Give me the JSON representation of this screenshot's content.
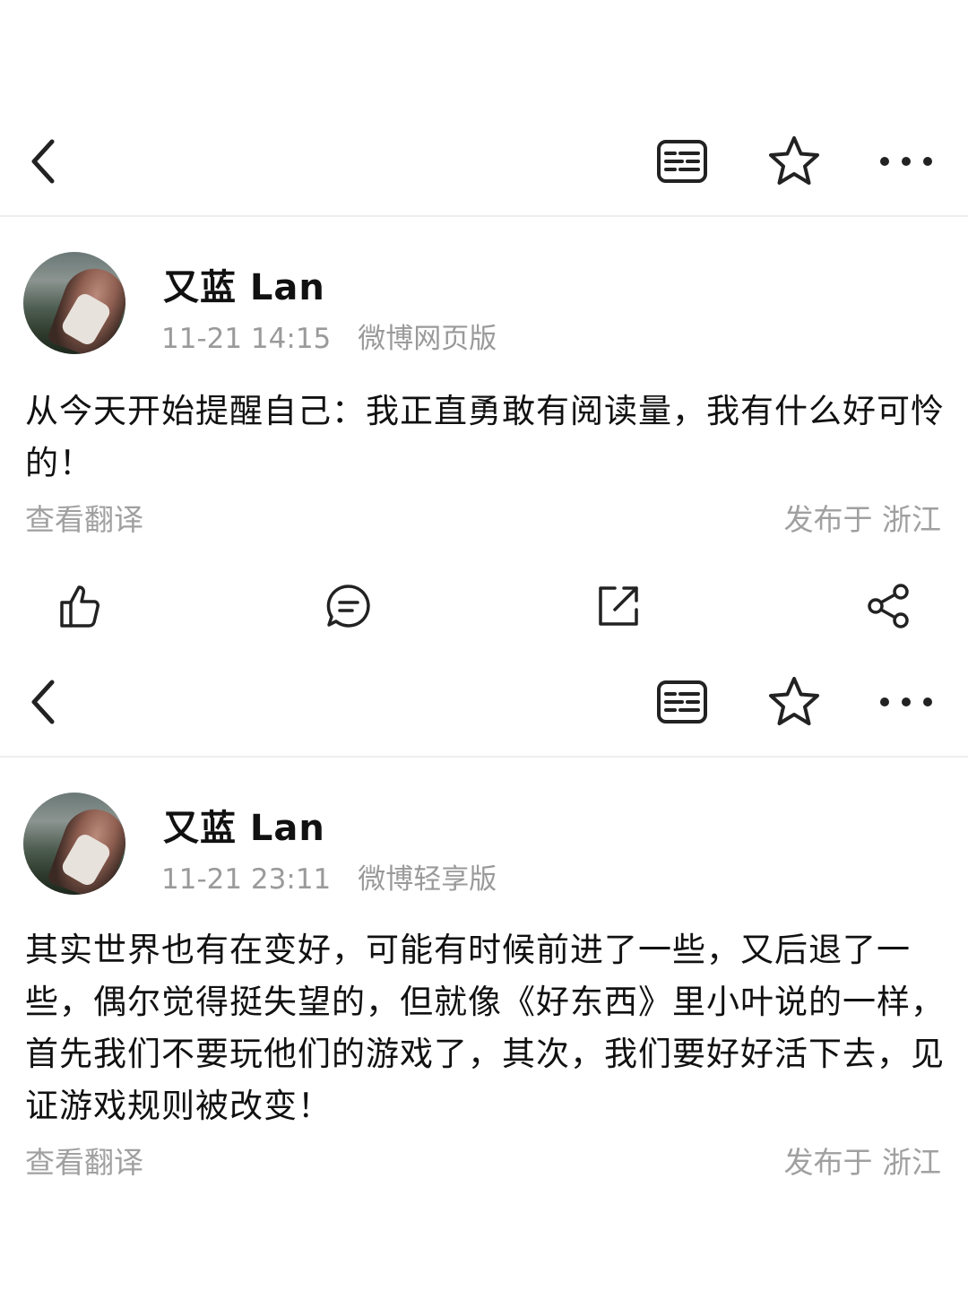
{
  "posts": [
    {
      "header": {
        "back_icon": "chevron-left-icon",
        "reader_icon": "reader-mode-icon",
        "favorite_icon": "star-outline-icon",
        "more_icon": "more-horizontal-icon"
      },
      "author": {
        "name": "又蓝 Lan",
        "avatar": "avatar-image"
      },
      "time": "11-21 14:15",
      "source": "微博网页版",
      "text": "从今天开始提醒自己：我正直勇敢有阅读量，我有什么好可怜的！",
      "translate_label": "查看翻译",
      "location_label": "发布于 浙江",
      "actions": [
        "like-icon",
        "comment-icon",
        "repost-icon",
        "share-icon"
      ]
    },
    {
      "header": {
        "back_icon": "chevron-left-icon",
        "reader_icon": "reader-mode-icon",
        "favorite_icon": "star-outline-icon",
        "more_icon": "more-horizontal-icon"
      },
      "author": {
        "name": "又蓝 Lan",
        "avatar": "avatar-image"
      },
      "time": "11-21 23:11",
      "source": "微博轻享版",
      "text": "其实世界也有在变好，可能有时候前进了一些，又后退了一些，偶尔觉得挺失望的，但就像《好东西》里小叶说的一样，首先我们不要玩他们的游戏了，其次，我们要好好活下去，见证游戏规则被改变！",
      "translate_label": "查看翻译",
      "location_label": "发布于 浙江"
    }
  ],
  "colors": {
    "text": "#111111",
    "secondary": "#9a9a9a",
    "divider": "#eeeeee",
    "icon": "#222222"
  }
}
